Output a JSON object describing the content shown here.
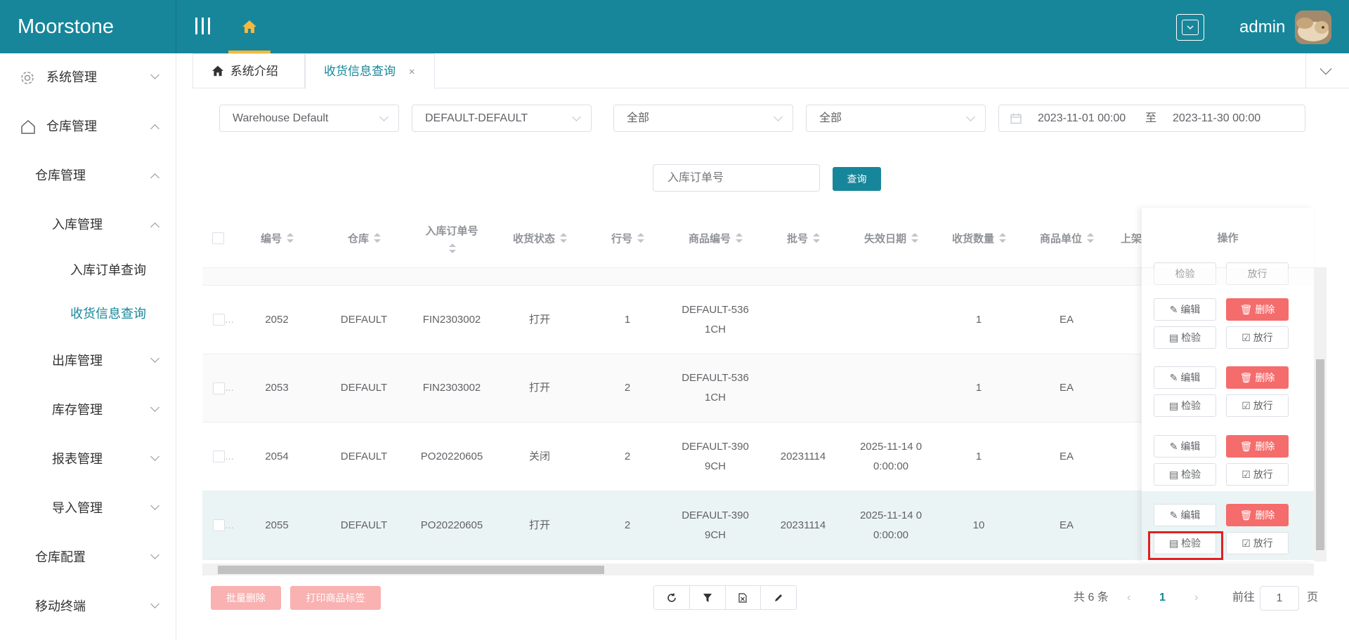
{
  "app": {
    "brand": "Moorstone",
    "user": "admin"
  },
  "sidebar": {
    "items": [
      {
        "label": "系统管理"
      },
      {
        "label": "仓库管理"
      },
      {
        "label": "仓库管理"
      },
      {
        "label": "入库管理"
      },
      {
        "label": "入库订单查询"
      },
      {
        "label": "收货信息查询"
      },
      {
        "label": "出库管理"
      },
      {
        "label": "库存管理"
      },
      {
        "label": "报表管理"
      },
      {
        "label": "导入管理"
      },
      {
        "label": "仓库配置"
      },
      {
        "label": "移动终端"
      }
    ]
  },
  "tabs": [
    {
      "label": "系统介绍"
    },
    {
      "label": "收货信息查询",
      "close": "×"
    }
  ],
  "filters": {
    "warehouse": "Warehouse Default",
    "owner": "DEFAULT-DEFAULT",
    "status1": "全部",
    "status2": "全部",
    "date_start": "2023-11-01 00:00",
    "date_sep": "至",
    "date_end": "2023-11-30 00:00",
    "order_placeholder": "入库订单号",
    "query_label": "查询"
  },
  "table": {
    "headers": {
      "id": "编号",
      "warehouse": "仓库",
      "order": "入库订单号",
      "status": "收货状态",
      "line": "行号",
      "sku": "商品编号",
      "lot": "批号",
      "expiry": "失效日期",
      "qty": "收货数量",
      "unit": "商品单位",
      "up": "上架",
      "ops": "操作"
    },
    "rows": [
      {
        "cb": "...",
        "id": "2052",
        "warehouse": "DEFAULT",
        "order": "FIN2303002",
        "status": "打开",
        "line": "1",
        "sku_a": "DEFAULT-536",
        "sku_b": "1CH",
        "lot": "",
        "exp_a": "",
        "exp_b": "",
        "qty": "1",
        "unit": "EA"
      },
      {
        "cb": "...",
        "id": "2053",
        "warehouse": "DEFAULT",
        "order": "FIN2303002",
        "status": "打开",
        "line": "2",
        "sku_a": "DEFAULT-536",
        "sku_b": "1CH",
        "lot": "",
        "exp_a": "",
        "exp_b": "",
        "qty": "1",
        "unit": "EA"
      },
      {
        "cb": "...",
        "id": "2054",
        "warehouse": "DEFAULT",
        "order": "PO20220605",
        "status": "关闭",
        "line": "2",
        "sku_a": "DEFAULT-390",
        "sku_b": "9CH",
        "lot": "20231114",
        "exp_a": "2025-11-14 0",
        "exp_b": "0:00:00",
        "qty": "1",
        "unit": "EA"
      },
      {
        "cb": "...",
        "id": "2055",
        "warehouse": "DEFAULT",
        "order": "PO20220605",
        "status": "打开",
        "line": "2",
        "sku_a": "DEFAULT-390",
        "sku_b": "9CH",
        "lot": "20231114",
        "exp_a": "2025-11-14 0",
        "exp_b": "0:00:00",
        "qty": "10",
        "unit": "EA"
      }
    ],
    "actions": {
      "edit": "编辑",
      "delete": "删除",
      "inspect": "检验",
      "release": "放行"
    }
  },
  "footer": {
    "batch_delete": "批量删除",
    "print_label": "打印商品标签",
    "total": "共 6 条",
    "page": "1",
    "goto_prefix": "前往",
    "goto_value": "1",
    "goto_suffix": "页"
  },
  "colors": {
    "primary": "#17869a",
    "danger": "#f56c6c",
    "highlight": "#e02020"
  }
}
